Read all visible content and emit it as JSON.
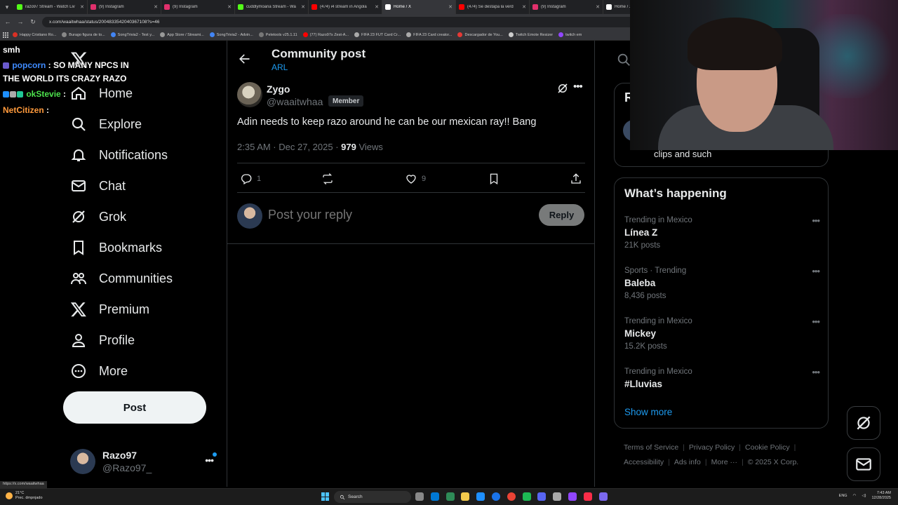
{
  "browser": {
    "tabs": [
      {
        "title": "razo97 Stream - Watch Liv",
        "color": "#53fc18"
      },
      {
        "title": "(9) Instagram",
        "color": "#e1306c"
      },
      {
        "title": "(9) Instagram",
        "color": "#e1306c"
      },
      {
        "title": "cuddlymoana Stream - Wa",
        "color": "#53fc18"
      },
      {
        "title": "(474) i4 stream in Angola",
        "color": "#ff0000"
      },
      {
        "title": "Home / X",
        "color": "#ffffff"
      },
      {
        "title": "(474) Se destapa la verd",
        "color": "#ff0000"
      },
      {
        "title": "(9) Instagram",
        "color": "#e1306c"
      },
      {
        "title": "Home / X",
        "color": "#ffffff"
      }
    ],
    "url": "x.com/waaitwhaa/status/2004833542040367108?s=46",
    "bookmarks": [
      {
        "label": "Happy Cristiano Ro...",
        "color": "#d93025"
      },
      {
        "label": "Burago figura de to...",
        "color": "#888888"
      },
      {
        "label": "SongTrivia2 - Test y...",
        "color": "#4285f4"
      },
      {
        "label": "App Store / Streami...",
        "color": "#999999"
      },
      {
        "label": "SongTrivia2 - Advin...",
        "color": "#4285f4"
      },
      {
        "label": "Peletools v25.1.11",
        "color": "#777777"
      },
      {
        "label": "(77) Razo97s Zest-A...",
        "color": "#ff0000"
      },
      {
        "label": "FIFA 23 FUT Card Cr...",
        "color": "#aaaaaa"
      },
      {
        "label": "FIFA 23 Card creator...",
        "color": "#aaaaaa"
      },
      {
        "label": "Descargador de You...",
        "color": "#e53935"
      },
      {
        "label": "Twitch Emote Resizer",
        "color": "#cccccc"
      },
      {
        "label": "twitch em",
        "color": "#9146ff"
      }
    ],
    "status_url": "https://x.com/waaitwhaa"
  },
  "nav": {
    "items": [
      {
        "label": "Home",
        "icon": "home-icon"
      },
      {
        "label": "Explore",
        "icon": "search-icon"
      },
      {
        "label": "Notifications",
        "icon": "bell-icon"
      },
      {
        "label": "Chat",
        "icon": "mail-icon"
      },
      {
        "label": "Grok",
        "icon": "grok-icon"
      },
      {
        "label": "Bookmarks",
        "icon": "bookmark-icon"
      },
      {
        "label": "Communities",
        "icon": "communities-icon"
      },
      {
        "label": "Premium",
        "icon": "x-premium-icon"
      },
      {
        "label": "Profile",
        "icon": "person-icon"
      },
      {
        "label": "More",
        "icon": "more-circle-icon"
      }
    ],
    "post_button": "Post",
    "account": {
      "name": "Razo97",
      "handle": "@Razo97_"
    }
  },
  "main": {
    "title": "Community post",
    "community": "ARL",
    "post": {
      "author": "Zygo",
      "handle": "@waaitwhaa",
      "badge": "Member",
      "text": "Adin needs to keep razo around he can be our mexican ray!! Bang",
      "timestamp": "2:35 AM · Dec 27, 2025 · ",
      "views_count": "979",
      "views_label": " Views",
      "replies": "1",
      "reposts": "",
      "likes": "9"
    },
    "reply_placeholder": "Post your reply",
    "reply_button": "Reply"
  },
  "sidebar": {
    "relevant_title": "R",
    "relevant_bio": "clips and such",
    "whats_happening": "What’s happening",
    "trends": [
      {
        "context": "Trending in Mexico",
        "name": "Línea Z",
        "posts": "21K posts"
      },
      {
        "context": "Sports · Trending",
        "name": "Baleba",
        "posts": "8,436 posts"
      },
      {
        "context": "Trending in Mexico",
        "name": "Mickey",
        "posts": "15.2K posts"
      },
      {
        "context": "Trending in Mexico",
        "name": "#Lluvias",
        "posts": ""
      }
    ],
    "show_more": "Show more",
    "footer": [
      "Terms of Service",
      "Privacy Policy",
      "Cookie Policy",
      "Accessibility",
      "Ads info",
      "More ···",
      "© 2025 X Corp."
    ]
  },
  "chat_overlay": {
    "lines": [
      {
        "user": "",
        "text": "smh",
        "color": "#ffffff"
      },
      {
        "user": "popcorn",
        "text": " : SO MANY NPCS IN",
        "color": "#3f8bff"
      },
      {
        "user": "",
        "text": "THE WORLD ITS CRAZY RAZO",
        "color": "#ffffff"
      },
      {
        "user": "okStevie",
        "text": " :",
        "color": "#4de34d"
      },
      {
        "user": "NetCitizen",
        "text": " :",
        "color": "#ff9a3c"
      }
    ]
  },
  "taskbar": {
    "weather_temp": "21°C",
    "weather_desc": "Prec. dmpnjado",
    "search": "Search",
    "lang": "ENG",
    "time": "7:43 AM",
    "date": "12/28/2025"
  }
}
